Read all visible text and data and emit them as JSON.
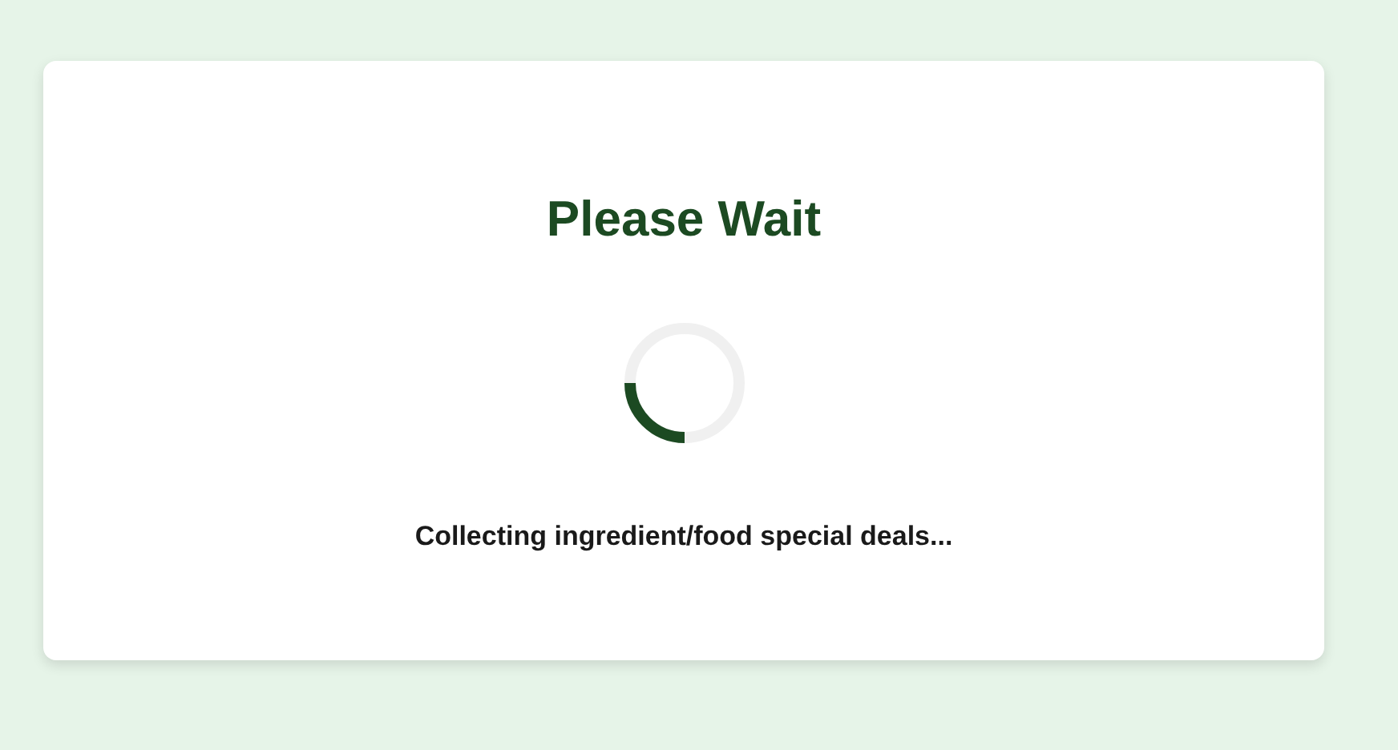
{
  "dialog": {
    "title": "Please Wait",
    "message": "Collecting ingredient/food special deals..."
  }
}
